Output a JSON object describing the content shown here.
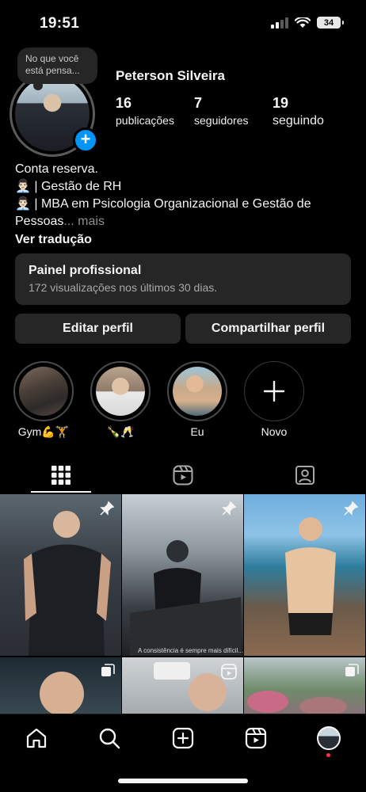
{
  "status_bar": {
    "time": "19:51",
    "battery": "34"
  },
  "profile": {
    "note": "No que você está pensa...",
    "username": "Peterson Silveira",
    "stats": [
      {
        "value": "16",
        "label": "publicações"
      },
      {
        "value": "7",
        "label": "seguidores"
      },
      {
        "value": "19",
        "label": "seguindo"
      }
    ],
    "bio": {
      "line1": "Conta reserva.",
      "line2": "| Gestão de RH",
      "line3": "| MBA em Psicologia Organizacional e Gestão de",
      "line4": "Pessoas",
      "more": "... mais",
      "translate": "Ver tradução"
    }
  },
  "dashboard": {
    "title": "Painel profissional",
    "subtitle": "172 visualizações nos últimos 30 dias."
  },
  "buttons": {
    "edit": "Editar perfil",
    "share": "Compartilhar perfil"
  },
  "highlights": [
    {
      "label": "Gym💪🏋️"
    },
    {
      "label": "🍾🥂"
    },
    {
      "label": "Eu"
    },
    {
      "label": "Novo"
    }
  ],
  "tabs": [
    "grid-icon",
    "reels-icon",
    "tagged-icon"
  ],
  "grid": {
    "caption": "A consistência é sempre mais difícil..."
  },
  "colors": {
    "accent": "#0095f6",
    "background": "#000000",
    "surface": "#262626",
    "notification": "#ff3040"
  }
}
